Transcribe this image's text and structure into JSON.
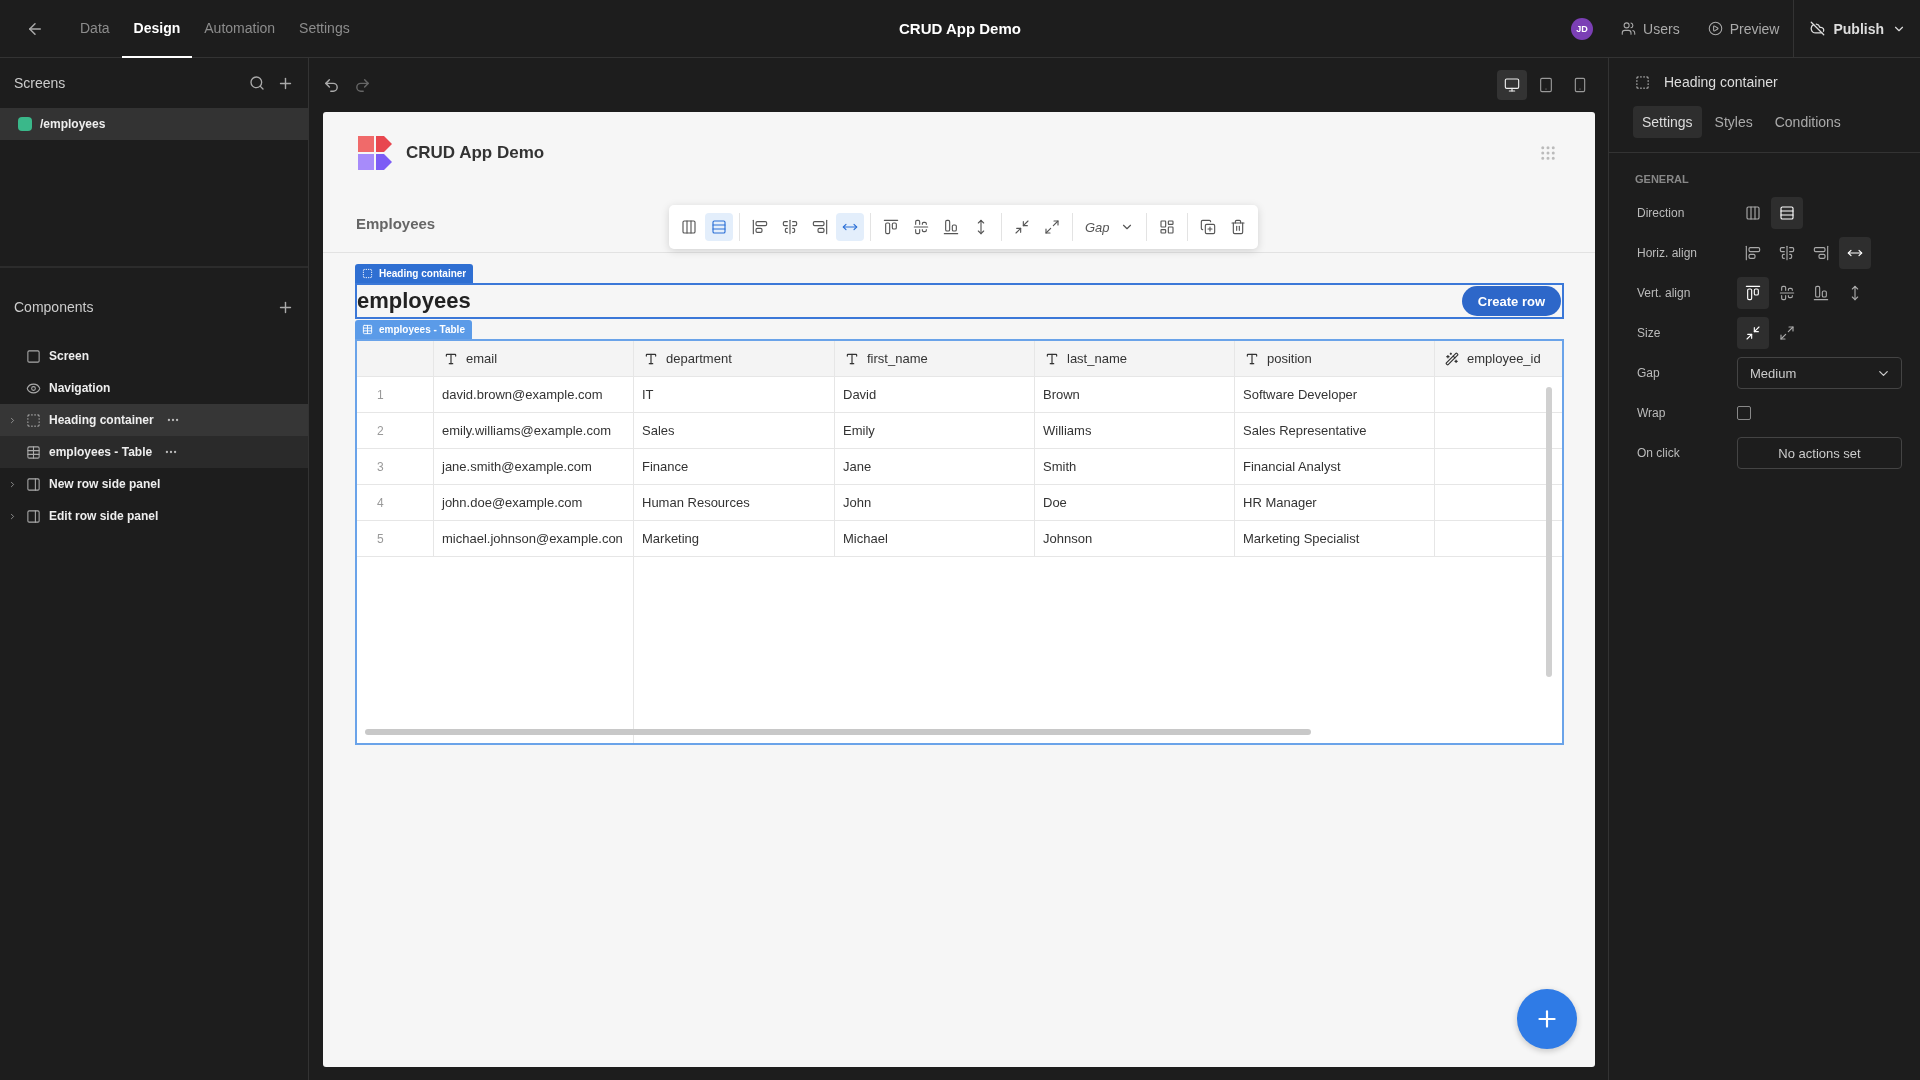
{
  "topbar": {
    "tabs": [
      {
        "label": "Data",
        "selected": false
      },
      {
        "label": "Design",
        "selected": true
      },
      {
        "label": "Automation",
        "selected": false
      },
      {
        "label": "Settings",
        "selected": false
      }
    ],
    "title": "CRUD App Demo",
    "avatar": "JD",
    "actions": [
      "Users",
      "Preview"
    ],
    "publish": "Publish"
  },
  "sidebar": {
    "screens_title": "Screens",
    "screens": [
      {
        "label": "/employees",
        "selected": true,
        "color": "#3ab88a"
      }
    ],
    "components_title": "Components",
    "components": [
      {
        "label": "Screen",
        "kind": "screen",
        "expandable": false,
        "selected": false,
        "has_menu": false
      },
      {
        "label": "Navigation",
        "kind": "navigation",
        "expandable": false,
        "selected": false,
        "has_menu": false
      },
      {
        "label": "Heading container",
        "kind": "container",
        "expandable": true,
        "selected": true,
        "has_menu": true
      },
      {
        "label": "employees - Table",
        "kind": "table",
        "expandable": false,
        "selected": false,
        "has_menu": true
      },
      {
        "label": "New row side panel",
        "kind": "panel",
        "expandable": true,
        "selected": false,
        "has_menu": false
      },
      {
        "label": "Edit row side panel",
        "kind": "panel",
        "expandable": true,
        "selected": false,
        "has_menu": false
      }
    ]
  },
  "devices": [
    {
      "selected": true
    },
    {
      "selected": false
    },
    {
      "selected": false
    }
  ],
  "app": {
    "title": "CRUD App Demo",
    "nav": "Employees",
    "toolbar": {
      "buttons": [
        {
          "selected": false
        },
        {
          "selected": true
        },
        {
          "selected": false
        },
        {
          "selected": false
        },
        {
          "selected": false
        },
        {
          "selected": true
        },
        {
          "selected": false
        },
        {
          "selected": false
        },
        {
          "selected": false
        },
        {
          "selected": false
        },
        {
          "selected": false
        },
        {
          "selected": false
        },
        {
          "selected": false
        },
        {
          "selected": false
        },
        {
          "selected": false
        }
      ],
      "gap_label": "Gap"
    },
    "heading_tag": "Heading container",
    "heading": "employees",
    "create_button": "Create row",
    "table_tag": "employees - Table",
    "table": {
      "columns": [
        {
          "label": "email",
          "kind": "text"
        },
        {
          "label": "department",
          "kind": "text"
        },
        {
          "label": "first_name",
          "kind": "text"
        },
        {
          "label": "last_name",
          "kind": "text"
        },
        {
          "label": "position",
          "kind": "text"
        },
        {
          "label": "employee_id",
          "kind": "auto"
        }
      ],
      "rows": [
        {
          "number": "1",
          "cells": [
            "david.brown@example.com",
            "IT",
            "David",
            "Brown",
            "Software Developer"
          ]
        },
        {
          "number": "2",
          "cells": [
            "emily.williams@example.com",
            "Sales",
            "Emily",
            "Williams",
            "Sales Representative"
          ]
        },
        {
          "number": "3",
          "cells": [
            "jane.smith@example.com",
            "Finance",
            "Jane",
            "Smith",
            "Financial Analyst"
          ]
        },
        {
          "number": "4",
          "cells": [
            "john.doe@example.com",
            "Human Resources",
            "John",
            "Doe",
            "HR Manager"
          ]
        },
        {
          "number": "5",
          "cells": [
            "michael.johnson@example.con",
            "Marketing",
            "Michael",
            "Johnson",
            "Marketing Specialist"
          ]
        }
      ]
    }
  },
  "panel": {
    "title": "Heading container",
    "tabs": [
      {
        "label": "Settings",
        "selected": true
      },
      {
        "label": "Styles",
        "selected": false
      },
      {
        "label": "Conditions",
        "selected": false
      }
    ],
    "section": "GENERAL",
    "settings": [
      {
        "label": "Direction",
        "kind": "direction",
        "options": [
          {
            "selected": false
          },
          {
            "selected": true
          }
        ]
      },
      {
        "label": "Horiz. align",
        "kind": "horizontal",
        "options": [
          {
            "selected": false
          },
          {
            "selected": false
          },
          {
            "selected": false
          },
          {
            "selected": true
          }
        ]
      },
      {
        "label": "Vert. align",
        "kind": "vertical",
        "options": [
          {
            "selected": true
          },
          {
            "selected": false
          },
          {
            "selected": false
          },
          {
            "selected": false
          }
        ]
      },
      {
        "label": "Size",
        "kind": "size",
        "options": [
          {
            "selected": true
          },
          {
            "selected": false
          }
        ]
      },
      {
        "label": "Gap",
        "kind": "select",
        "value": "Medium"
      },
      {
        "label": "Wrap",
        "kind": "checkbox",
        "checked": false
      },
      {
        "label": "On click",
        "kind": "button",
        "value": "No actions set"
      }
    ]
  }
}
